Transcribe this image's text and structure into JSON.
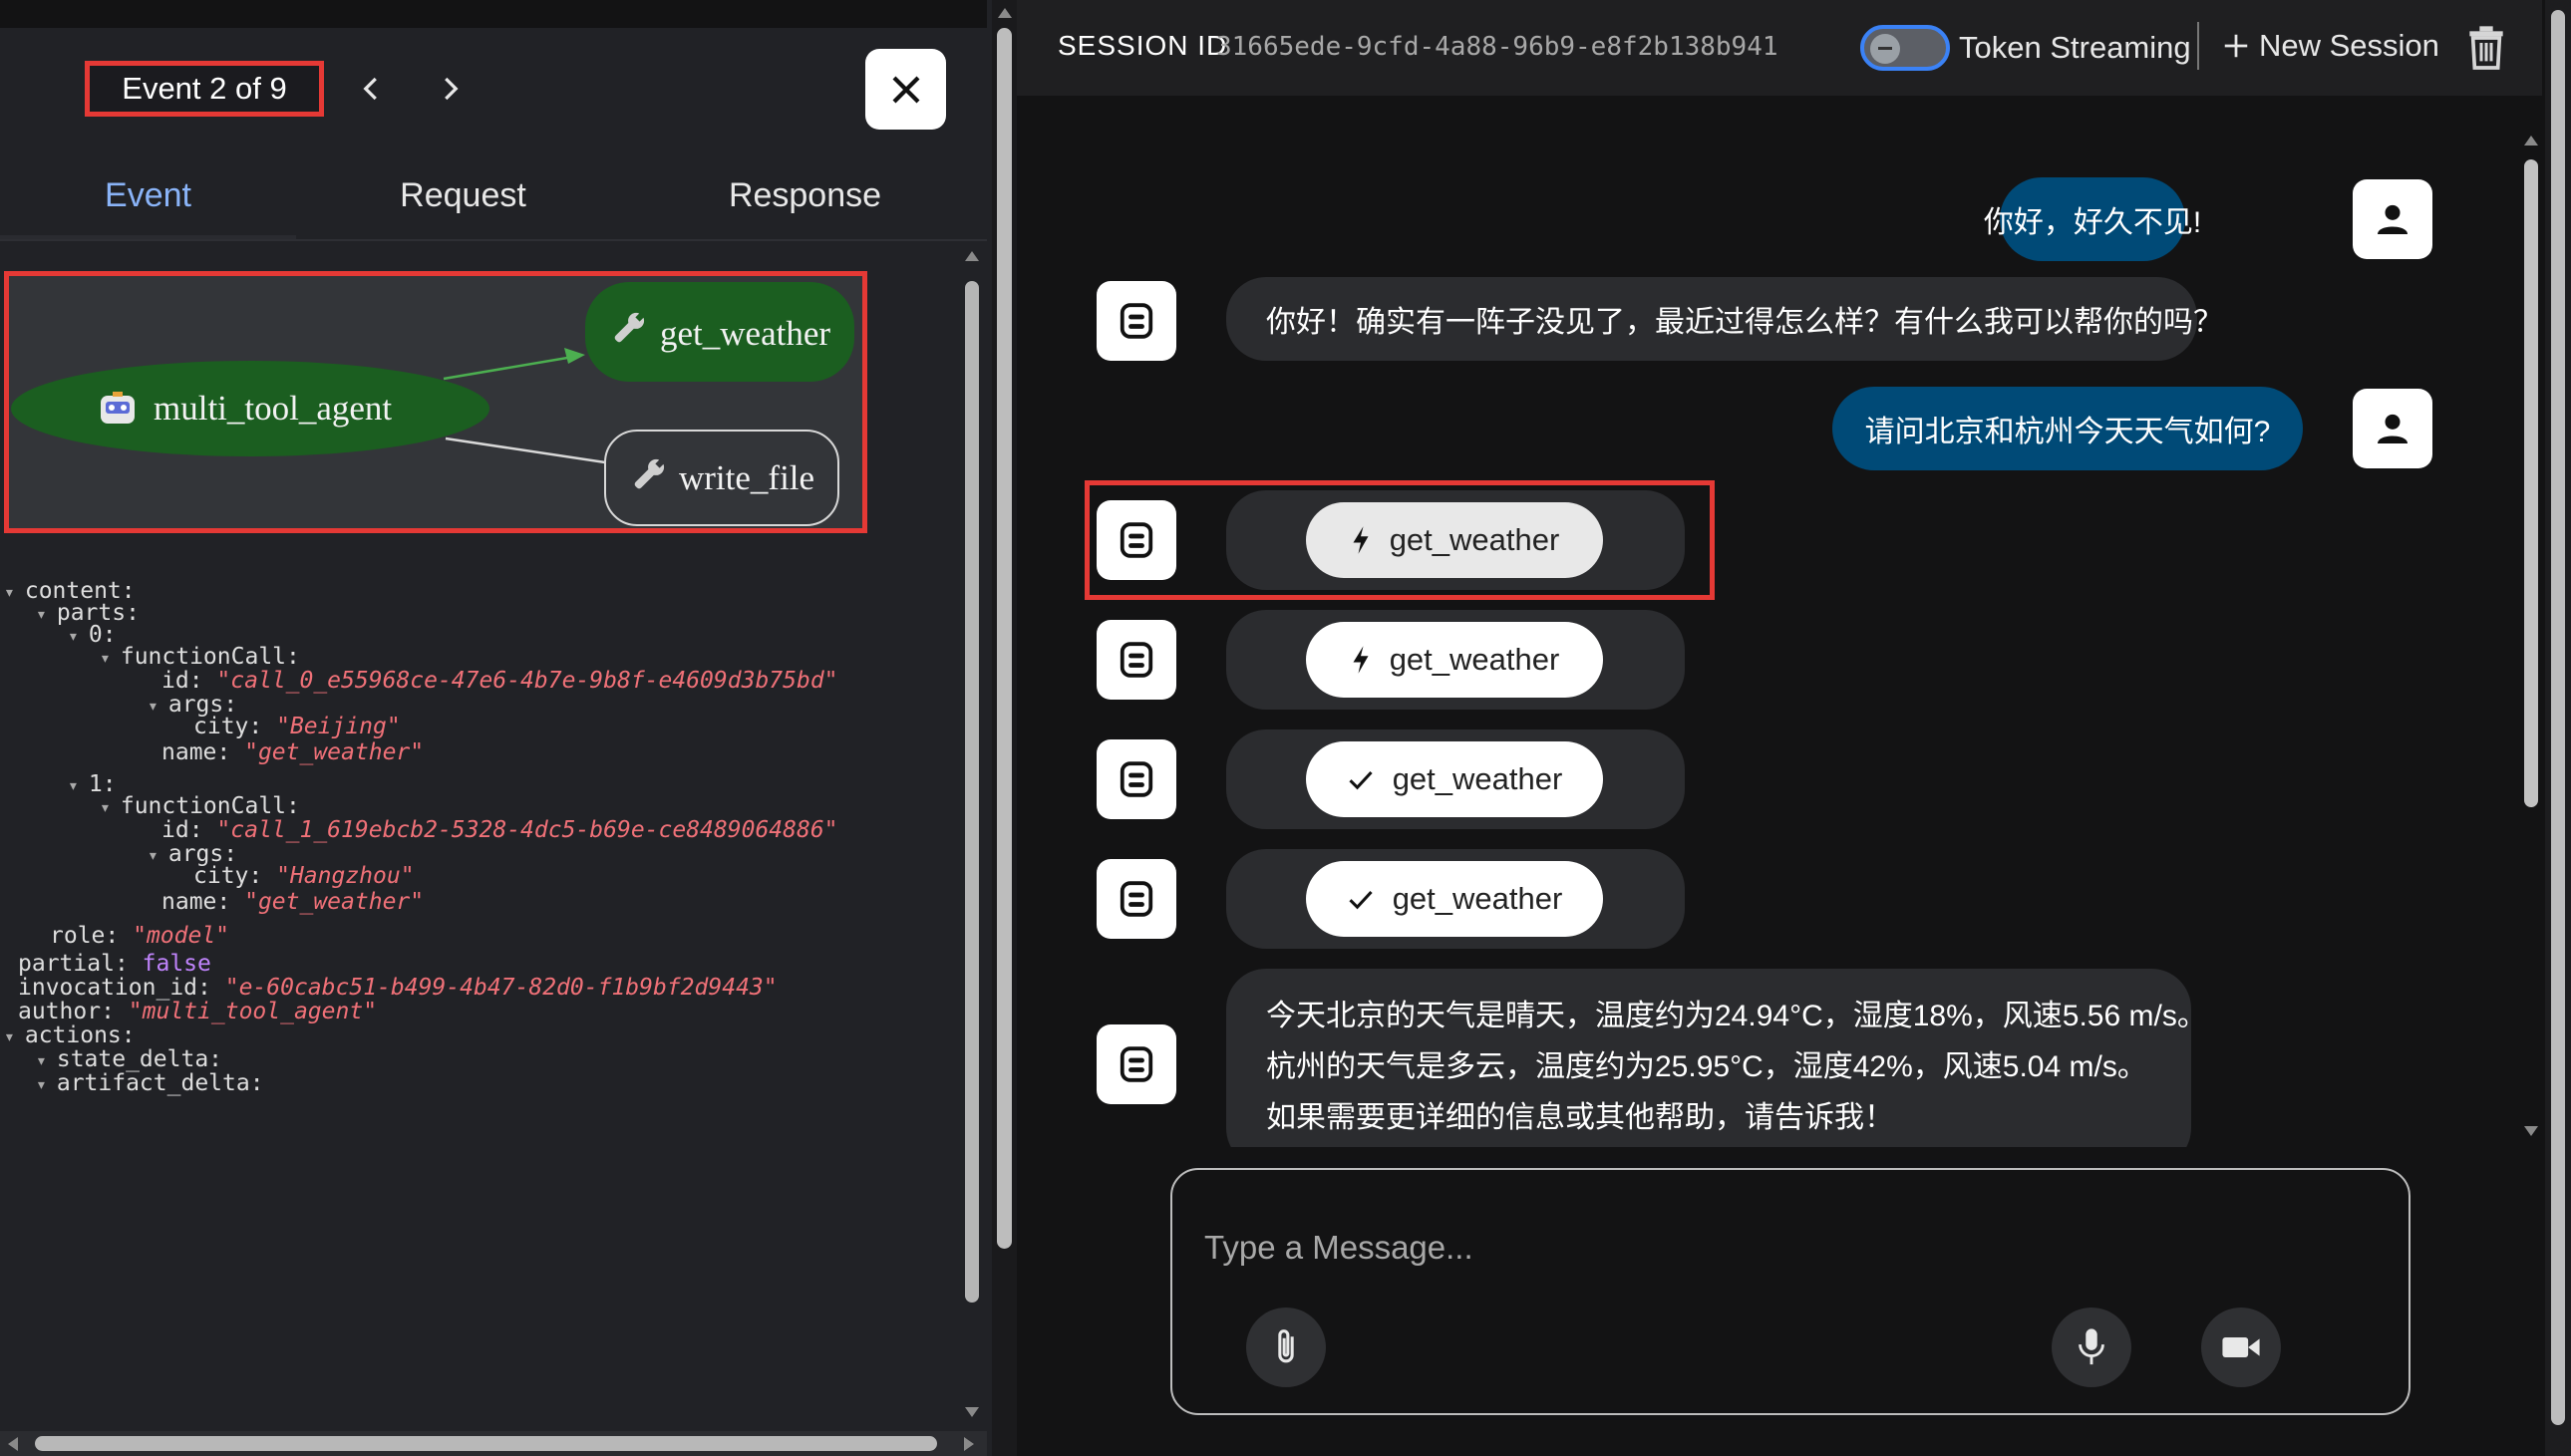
{
  "trace": {
    "event_counter": "Event 2 of 9",
    "tabs": [
      "Event",
      "Request",
      "Response"
    ],
    "graph": {
      "agent_node": "multi_tool_agent",
      "tool_nodes": [
        "get_weather",
        "write_file"
      ],
      "active_tool": "get_weather",
      "colors": {
        "active_node": "#1b5e20",
        "edge_active": "#4caf50",
        "edge": "#d0d0d0"
      }
    },
    "json_lines": [
      {
        "indent": 0,
        "tri": true,
        "key": "content",
        "val": "",
        "type": "k"
      },
      {
        "indent": 1,
        "tri": true,
        "key": "parts",
        "val": "",
        "type": "k"
      },
      {
        "indent": 2,
        "tri": true,
        "key": "0",
        "val": "",
        "type": "k"
      },
      {
        "indent": 3,
        "tri": true,
        "key": "functionCall",
        "val": "",
        "type": "k"
      },
      {
        "indent": 4,
        "tri": false,
        "key": "id",
        "val": "\"call_0_e55968ce-47e6-4b7e-9b8f-e4609d3b75bd\"",
        "type": "s"
      },
      {
        "indent": 4,
        "tri": true,
        "key": "args",
        "val": "",
        "type": "k"
      },
      {
        "indent": 5,
        "tri": false,
        "key": "city",
        "val": "\"Beijing\"",
        "type": "s"
      },
      {
        "indent": 4,
        "tri": false,
        "key": "name",
        "val": "\"get_weather\"",
        "type": "s"
      },
      {
        "indent": 2,
        "tri": true,
        "key": "1",
        "val": "",
        "type": "k"
      },
      {
        "indent": 3,
        "tri": true,
        "key": "functionCall",
        "val": "",
        "type": "k"
      },
      {
        "indent": 4,
        "tri": false,
        "key": "id",
        "val": "\"call_1_619ebcb2-5328-4dc5-b69e-ce8489064886\"",
        "type": "s"
      },
      {
        "indent": 4,
        "tri": true,
        "key": "args",
        "val": "",
        "type": "k"
      },
      {
        "indent": 5,
        "tri": false,
        "key": "city",
        "val": "\"Hangzhou\"",
        "type": "s"
      },
      {
        "indent": 4,
        "tri": false,
        "key": "name",
        "val": "\"get_weather\"",
        "type": "s"
      },
      {
        "indent": 1,
        "tri": false,
        "key": "role",
        "val": "\"model\"",
        "type": "s"
      },
      {
        "indent": 0,
        "tri": false,
        "key": "partial",
        "val": "false",
        "type": "b"
      },
      {
        "indent": 0,
        "tri": false,
        "key": "invocation_id",
        "val": "\"e-60cabc51-b499-4b47-82d0-f1b9bf2d9443\"",
        "type": "s"
      },
      {
        "indent": 0,
        "tri": false,
        "key": "author",
        "val": "\"multi_tool_agent\"",
        "type": "s"
      },
      {
        "indent": 0,
        "tri": true,
        "key": "actions",
        "val": "",
        "type": "k"
      },
      {
        "indent": 1,
        "tri": true,
        "key": "state_delta",
        "val": "",
        "type": "k"
      },
      {
        "indent": 1,
        "tri": true,
        "key": "artifact_delta",
        "val": "",
        "type": "k"
      }
    ]
  },
  "header": {
    "session_label": "SESSION ID",
    "session_id": "31665ede-9cfd-4a88-96b9-e8f2b138b941",
    "token_streaming_label": "Token Streaming",
    "token_streaming_on": false,
    "new_session_label": "New Session"
  },
  "chat": {
    "messages": [
      {
        "role": "user",
        "text": "你好，好久不见!"
      },
      {
        "role": "bot",
        "text": "你好！确实有一阵子没见了，最近过得怎么样？有什么我可以帮你的吗？"
      },
      {
        "role": "user",
        "text": "请问北京和杭州今天天气如何?"
      },
      {
        "role": "bot-tool",
        "tool": "get_weather",
        "status": "call",
        "icon": "bolt-icon"
      },
      {
        "role": "bot-tool",
        "tool": "get_weather",
        "status": "call",
        "icon": "bolt-icon"
      },
      {
        "role": "bot-tool",
        "tool": "get_weather",
        "status": "done",
        "icon": "check-icon"
      },
      {
        "role": "bot-tool",
        "tool": "get_weather",
        "status": "done",
        "icon": "check-icon"
      },
      {
        "role": "bot",
        "lines": [
          "今天北京的天气是晴天，温度约为24.94°C，湿度18%，风速5.56 m/s。",
          "杭州的天气是多云，温度约为25.95°C，湿度42%，风速5.04 m/s。",
          "如果需要更详细的信息或其他帮助，请告诉我！"
        ]
      }
    ],
    "input_placeholder": "Type a Message..."
  }
}
